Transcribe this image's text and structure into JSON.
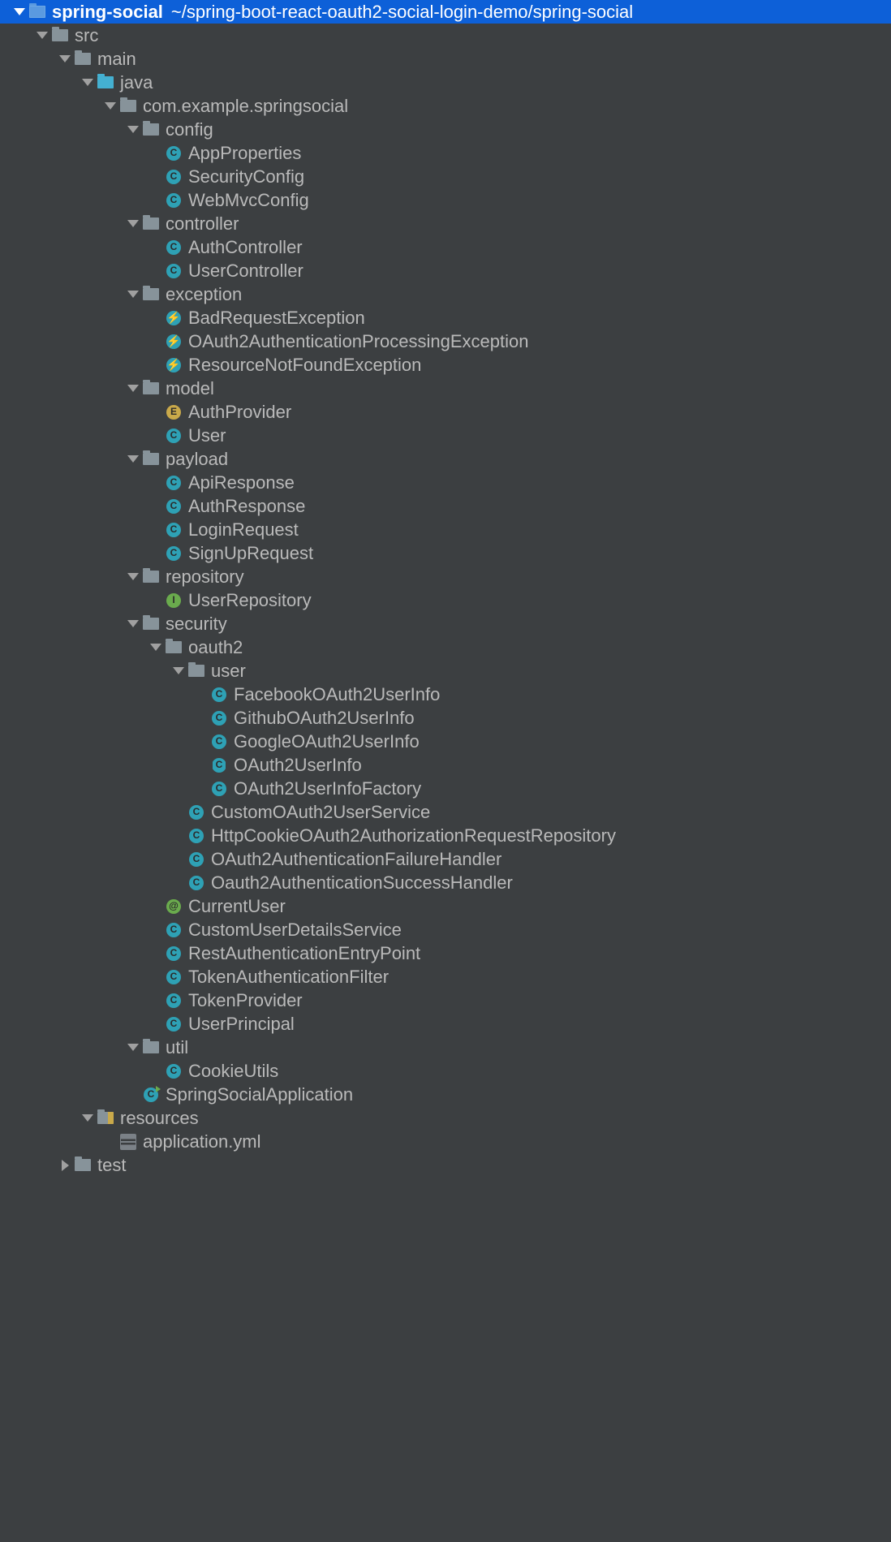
{
  "colors": {
    "background": "#3c3f41",
    "selection": "#0d60d8",
    "text": "#bababa",
    "class_icon": "#2ea1b5",
    "interface_icon": "#6aab4d",
    "enum_icon": "#c9a94a"
  },
  "tree": [
    {
      "depth": 0,
      "arrow": "open",
      "icon": "module-folder",
      "label": "spring-social",
      "bold": true,
      "selected": true,
      "path": "~/spring-boot-react-oauth2-social-login-demo/spring-social"
    },
    {
      "depth": 1,
      "arrow": "open",
      "icon": "folder",
      "label": "src"
    },
    {
      "depth": 2,
      "arrow": "open",
      "icon": "folder",
      "label": "main"
    },
    {
      "depth": 3,
      "arrow": "open",
      "icon": "java-folder",
      "label": "java"
    },
    {
      "depth": 4,
      "arrow": "open",
      "icon": "folder",
      "label": "com.example.springsocial"
    },
    {
      "depth": 5,
      "arrow": "open",
      "icon": "folder",
      "label": "config"
    },
    {
      "depth": 6,
      "arrow": "none",
      "icon": "class",
      "label": "AppProperties"
    },
    {
      "depth": 6,
      "arrow": "none",
      "icon": "class",
      "label": "SecurityConfig"
    },
    {
      "depth": 6,
      "arrow": "none",
      "icon": "class",
      "label": "WebMvcConfig"
    },
    {
      "depth": 5,
      "arrow": "open",
      "icon": "folder",
      "label": "controller"
    },
    {
      "depth": 6,
      "arrow": "none",
      "icon": "class",
      "label": "AuthController"
    },
    {
      "depth": 6,
      "arrow": "none",
      "icon": "class",
      "label": "UserController"
    },
    {
      "depth": 5,
      "arrow": "open",
      "icon": "folder",
      "label": "exception"
    },
    {
      "depth": 6,
      "arrow": "none",
      "icon": "exception",
      "label": "BadRequestException"
    },
    {
      "depth": 6,
      "arrow": "none",
      "icon": "exception",
      "label": "OAuth2AuthenticationProcessingException"
    },
    {
      "depth": 6,
      "arrow": "none",
      "icon": "exception",
      "label": "ResourceNotFoundException"
    },
    {
      "depth": 5,
      "arrow": "open",
      "icon": "folder",
      "label": "model"
    },
    {
      "depth": 6,
      "arrow": "none",
      "icon": "enum",
      "label": "AuthProvider"
    },
    {
      "depth": 6,
      "arrow": "none",
      "icon": "class",
      "label": "User"
    },
    {
      "depth": 5,
      "arrow": "open",
      "icon": "folder",
      "label": "payload"
    },
    {
      "depth": 6,
      "arrow": "none",
      "icon": "class",
      "label": "ApiResponse"
    },
    {
      "depth": 6,
      "arrow": "none",
      "icon": "class",
      "label": "AuthResponse"
    },
    {
      "depth": 6,
      "arrow": "none",
      "icon": "class",
      "label": "LoginRequest"
    },
    {
      "depth": 6,
      "arrow": "none",
      "icon": "class",
      "label": "SignUpRequest"
    },
    {
      "depth": 5,
      "arrow": "open",
      "icon": "folder",
      "label": "repository"
    },
    {
      "depth": 6,
      "arrow": "none",
      "icon": "interface",
      "label": "UserRepository"
    },
    {
      "depth": 5,
      "arrow": "open",
      "icon": "folder",
      "label": "security"
    },
    {
      "depth": 6,
      "arrow": "open",
      "icon": "folder",
      "label": "oauth2"
    },
    {
      "depth": 7,
      "arrow": "open",
      "icon": "folder",
      "label": "user"
    },
    {
      "depth": 8,
      "arrow": "none",
      "icon": "class",
      "label": "FacebookOAuth2UserInfo"
    },
    {
      "depth": 8,
      "arrow": "none",
      "icon": "class",
      "label": "GithubOAuth2UserInfo"
    },
    {
      "depth": 8,
      "arrow": "none",
      "icon": "class",
      "label": "GoogleOAuth2UserInfo"
    },
    {
      "depth": 8,
      "arrow": "none",
      "icon": "abstract",
      "label": "OAuth2UserInfo"
    },
    {
      "depth": 8,
      "arrow": "none",
      "icon": "class",
      "label": "OAuth2UserInfoFactory"
    },
    {
      "depth": 7,
      "arrow": "none",
      "icon": "class",
      "label": "CustomOAuth2UserService"
    },
    {
      "depth": 7,
      "arrow": "none",
      "icon": "class",
      "label": "HttpCookieOAuth2AuthorizationRequestRepository"
    },
    {
      "depth": 7,
      "arrow": "none",
      "icon": "class",
      "label": "OAuth2AuthenticationFailureHandler"
    },
    {
      "depth": 7,
      "arrow": "none",
      "icon": "class",
      "label": "Oauth2AuthenticationSuccessHandler"
    },
    {
      "depth": 6,
      "arrow": "none",
      "icon": "annotation",
      "label": "CurrentUser"
    },
    {
      "depth": 6,
      "arrow": "none",
      "icon": "class",
      "label": "CustomUserDetailsService"
    },
    {
      "depth": 6,
      "arrow": "none",
      "icon": "class",
      "label": "RestAuthenticationEntryPoint"
    },
    {
      "depth": 6,
      "arrow": "none",
      "icon": "class",
      "label": "TokenAuthenticationFilter"
    },
    {
      "depth": 6,
      "arrow": "none",
      "icon": "class",
      "label": "TokenProvider"
    },
    {
      "depth": 6,
      "arrow": "none",
      "icon": "class",
      "label": "UserPrincipal"
    },
    {
      "depth": 5,
      "arrow": "open",
      "icon": "folder",
      "label": "util"
    },
    {
      "depth": 6,
      "arrow": "none",
      "icon": "class",
      "label": "CookieUtils"
    },
    {
      "depth": 5,
      "arrow": "none",
      "icon": "runnable",
      "label": "SpringSocialApplication"
    },
    {
      "depth": 3,
      "arrow": "open",
      "icon": "resources-folder",
      "label": "resources"
    },
    {
      "depth": 4,
      "arrow": "none",
      "icon": "yml",
      "label": "application.yml"
    },
    {
      "depth": 2,
      "arrow": "closed",
      "icon": "folder",
      "label": "test"
    }
  ]
}
